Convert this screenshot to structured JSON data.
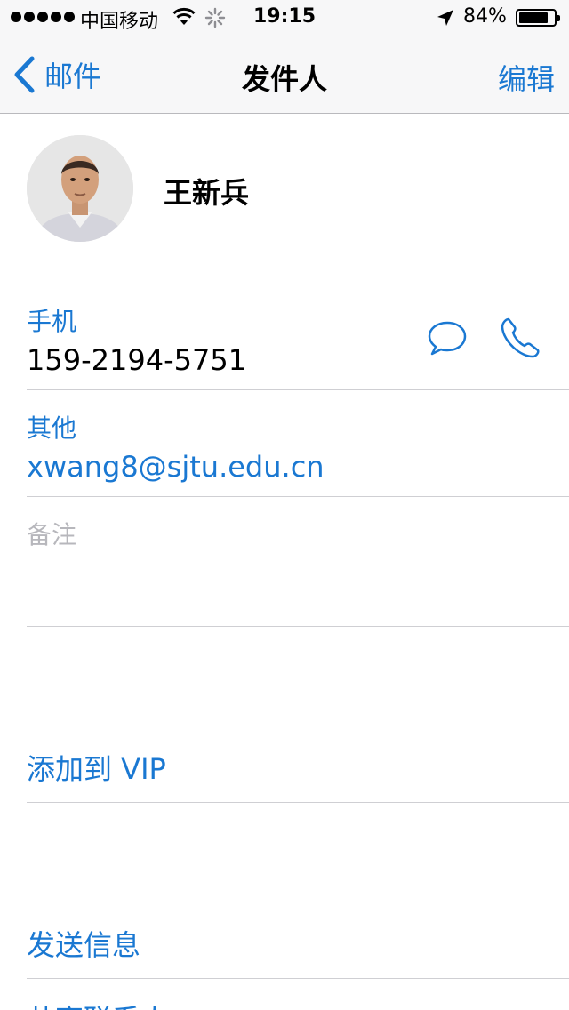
{
  "status_bar": {
    "carrier": "中国移动",
    "time": "19:15",
    "battery_percent": "84%",
    "battery_level": 0.84
  },
  "nav": {
    "back_label": "邮件",
    "title": "发件人",
    "edit_label": "编辑"
  },
  "contact": {
    "name": "王新兵"
  },
  "fields": {
    "phone": {
      "label": "手机",
      "value": "159-2194-5751"
    },
    "email": {
      "label": "其他",
      "value": "xwang8@sjtu.edu.cn"
    },
    "notes": {
      "label": "备注"
    }
  },
  "actions": {
    "add_vip": "添加到 VIP",
    "send_message": "发送信息",
    "share_contact": "共享联系人"
  },
  "colors": {
    "accent": "#1a78d2",
    "separator": "#cfcfd3",
    "nav_background": "#f7f7f8",
    "muted": "#b7b7bc"
  },
  "icons": [
    "wifi-icon",
    "activity-spinner-icon",
    "location-arrow-icon",
    "battery-icon",
    "back-chevron-icon",
    "message-bubble-icon",
    "phone-icon"
  ]
}
